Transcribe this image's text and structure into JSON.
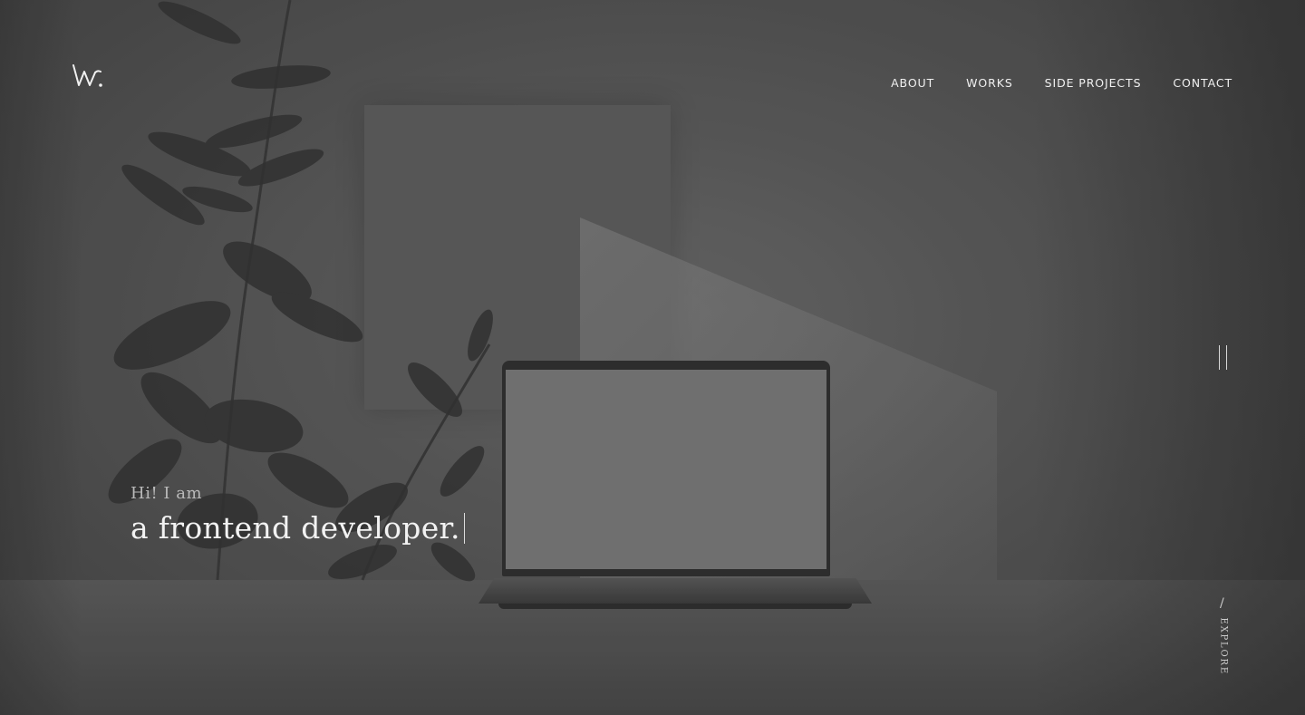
{
  "logo": {
    "text": "w.",
    "icon": "w-logo-icon"
  },
  "nav": {
    "items": [
      {
        "label": "ABOUT"
      },
      {
        "label": "WORKS"
      },
      {
        "label": "SIDE PROJECTS"
      },
      {
        "label": "CONTACT"
      }
    ]
  },
  "hero": {
    "intro": "Hi! I am",
    "title": "a frontend developer."
  },
  "controls": {
    "pause_icon": "pause-icon",
    "explore_label": "EXPLORE",
    "explore_slash": "/"
  },
  "colors": {
    "background": "#4a4a4a",
    "text_primary": "#f2f2f2",
    "text_muted": "#b9b9b9"
  }
}
